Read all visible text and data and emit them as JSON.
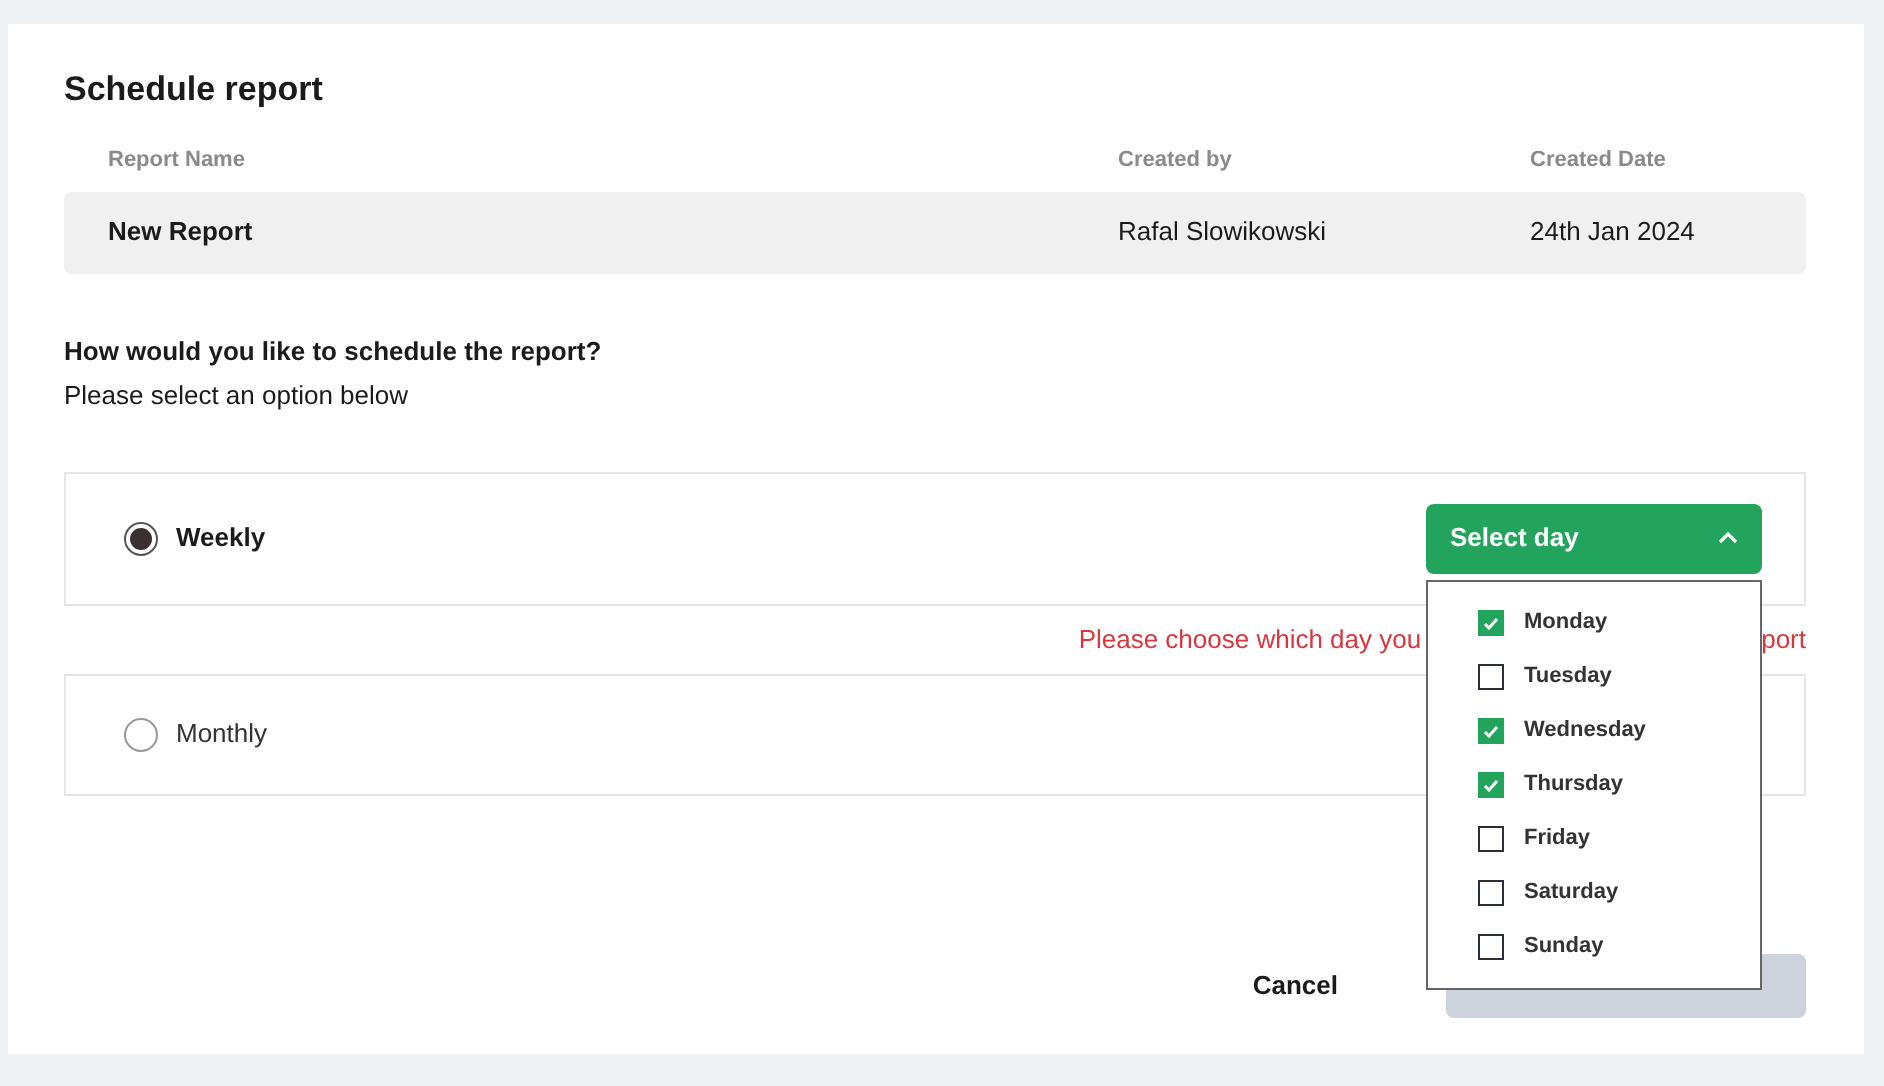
{
  "title": "Schedule report",
  "table": {
    "columns": [
      "Report Name",
      "Created by",
      "Created Date"
    ],
    "rows": [
      [
        "New Report",
        "Rafal Slowikowski",
        "24th Jan 2024"
      ]
    ]
  },
  "question": "How would you like to schedule the report?",
  "hint": "Please select an option below",
  "options": [
    {
      "label": "Weekly",
      "selected": true
    },
    {
      "label": "Monthly",
      "selected": false
    }
  ],
  "dropdown": {
    "label": "Select day",
    "expanded": true,
    "items": [
      {
        "label": "Monday",
        "checked": true
      },
      {
        "label": "Tuesday",
        "checked": false
      },
      {
        "label": "Wednesday",
        "checked": true
      },
      {
        "label": "Thursday",
        "checked": true
      },
      {
        "label": "Friday",
        "checked": false
      },
      {
        "label": "Saturday",
        "checked": false
      },
      {
        "label": "Sunday",
        "checked": false
      }
    ]
  },
  "error": {
    "visible_start": "Please choose which day you",
    "visible_end": "port"
  },
  "buttons": {
    "cancel": "Cancel"
  }
}
